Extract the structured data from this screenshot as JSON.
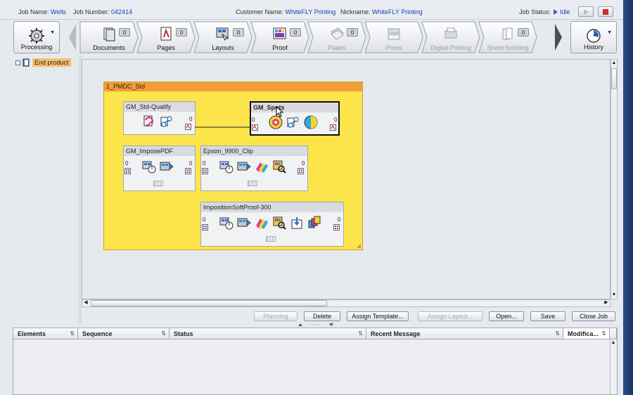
{
  "header": {
    "job_name_label": "Job Name:",
    "job_name": "Wells",
    "job_number_label": "Job Number:",
    "job_number": "042414",
    "customer_label": "Customer Name:",
    "customer": "WhiteFLY Printing",
    "nickname_label": "Nickname:",
    "nickname": "WhiteFLY Printing",
    "status_label": "Job Status:",
    "status": "Idle"
  },
  "toolbar": {
    "processing_label": "Processing",
    "history_label": "History",
    "stages": [
      {
        "label": "Documents",
        "count": "0",
        "icon": "documents-icon",
        "enabled": true
      },
      {
        "label": "Pages",
        "count": "0",
        "icon": "pages-icon",
        "enabled": true
      },
      {
        "label": "Layouts",
        "count": "0",
        "icon": "layouts-icon",
        "enabled": true
      },
      {
        "label": "Proof",
        "count": "0",
        "icon": "proof-icon",
        "enabled": true
      },
      {
        "label": "Plates",
        "count": "0",
        "icon": "plates-icon",
        "enabled": false
      },
      {
        "label": "Press",
        "count": "",
        "icon": "press-icon",
        "enabled": false
      },
      {
        "label": "Digital Printing",
        "count": "",
        "icon": "digital-printing-icon",
        "enabled": false
      },
      {
        "label": "Sheet finishing",
        "count": "0",
        "icon": "sheet-finishing-icon",
        "enabled": false
      }
    ]
  },
  "tree": {
    "end_product": "End product"
  },
  "canvas": {
    "group_title": "1_PMDC_Std",
    "templates": [
      {
        "title": "GM_Std-Qualify",
        "in": "",
        "out": "0"
      },
      {
        "title": "GM_Spots",
        "in": "0",
        "out": "0"
      },
      {
        "title": "GM_ImposePDF",
        "in": "0",
        "out": "0"
      },
      {
        "title": "Epson_9900_Clip",
        "in": "0",
        "out": "0"
      },
      {
        "title": "ImpositionSoftProof-300",
        "in": "0",
        "out": "0"
      }
    ]
  },
  "actions": {
    "planning": "Planning",
    "delete": "Delete",
    "assign_template": "Assign Template...",
    "assign_layout": "Assign Layout...",
    "open": "Open...",
    "save": "Save",
    "close_job": "Close Job"
  },
  "table": {
    "columns": [
      "Elements",
      "Sequence",
      "Status",
      "Recent Message",
      "Modifica..."
    ]
  },
  "colors": {
    "accent_blue": "#1a40b8",
    "group_bg": "#fbe54a",
    "group_header": "#f39c3a",
    "tree_highlight": "#f6c070"
  }
}
